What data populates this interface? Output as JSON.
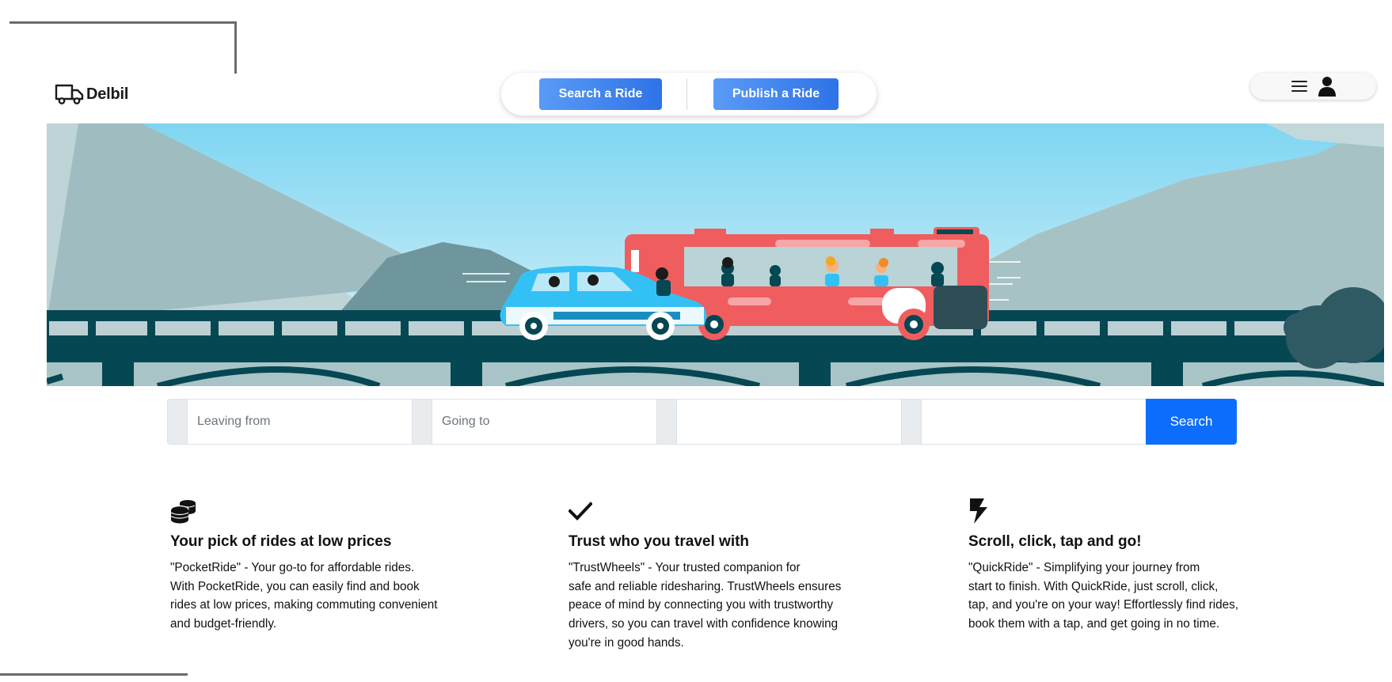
{
  "brand": {
    "name": "Delbil",
    "logo_icon": "truck-icon"
  },
  "nav": {
    "search_label": "Search a Ride",
    "publish_label": "Publish a Ride"
  },
  "user_menu": {
    "menu_icon": "hamburger-icon",
    "user_icon": "user-icon"
  },
  "hero": {
    "illustration": "bridge-bus-car-illustration"
  },
  "search": {
    "from_placeholder": "Leaving from",
    "to_placeholder": "Going to",
    "date_value": "",
    "passengers_value": "",
    "button_label": "Search"
  },
  "features": [
    {
      "icon": "coins-icon",
      "title": "Your pick of rides at low prices",
      "lines": [
        "\"PocketRide\" - Your go-to for affordable rides.",
        "With PocketRide, you can easily find and book",
        "rides at low prices, making commuting convenient",
        "and budget-friendly."
      ]
    },
    {
      "icon": "checkmark-icon",
      "title": "Trust who you travel with",
      "lines": [
        "\"TrustWheels\" - Your trusted companion for",
        "safe and reliable ridesharing. TrustWheels ensures",
        "peace of mind by connecting you with trustworthy",
        "drivers, so you can travel with confidence knowing",
        "you're in good hands."
      ]
    },
    {
      "icon": "bolt-icon",
      "title": "Scroll, click, tap and go!",
      "lines": [
        "\"QuickRide\" - Simplifying your journey from",
        "start to finish. With QuickRide, just scroll, click,",
        "tap, and you're on your way! Effortlessly find rides,",
        "book them with a tap, and get going in no time."
      ]
    }
  ],
  "colors": {
    "primary": "#0d6efd",
    "nav_gradient_start": "#5a9bf5",
    "nav_gradient_end": "#2e73e8",
    "bridge": "#054752",
    "bus": "#f05d5e",
    "car": "#33c1f5",
    "sky_top": "#7fd6f2"
  }
}
